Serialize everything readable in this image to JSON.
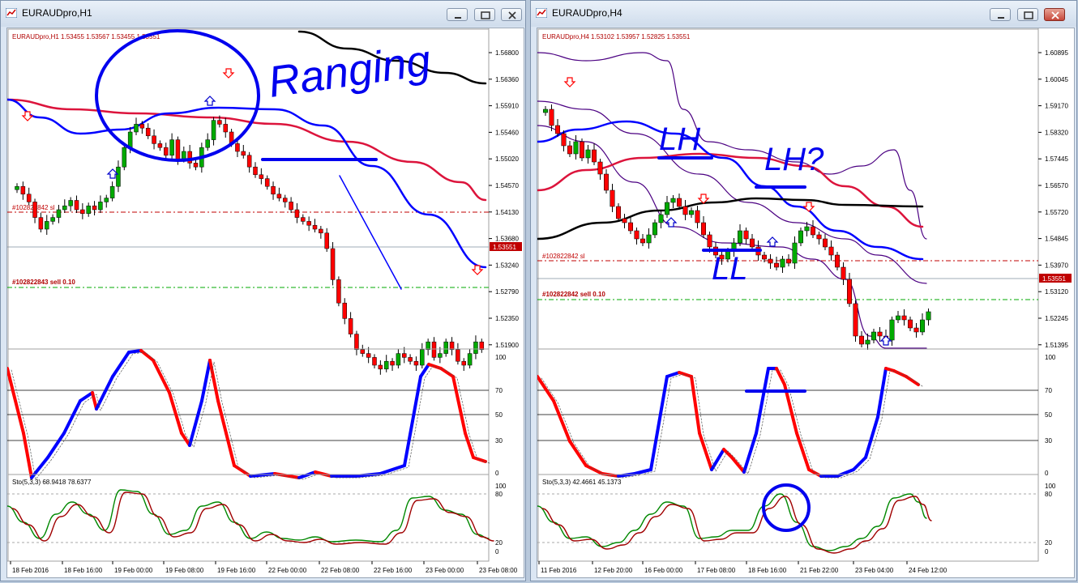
{
  "windows": [
    {
      "title": "EURAUDpro,H1",
      "header": "EURAUDpro,H1  1.53455 1.53567 1.53455 1.53551",
      "price_labels": [
        "1.56800",
        "1.56360",
        "1.55910",
        "1.55460",
        "1.55020",
        "1.54570",
        "1.54130",
        "1.53680",
        "1.53240",
        "1.52790",
        "1.52350",
        "1.51900"
      ],
      "current_price": "1.53551",
      "sl_label": "#102822842 sl",
      "sell_label": "#102822843 sell 0.10",
      "rsi_levels": [
        "100",
        "70",
        "50",
        "30",
        "0"
      ],
      "sto_label": "Sto(5,3,3) 68.9418 78.6377",
      "sto_levels": [
        "100",
        "80",
        "20",
        "0"
      ],
      "time_labels": [
        "18 Feb 2016",
        "18 Feb 16:00",
        "19 Feb 00:00",
        "19 Feb 08:00",
        "19 Feb 16:00",
        "22 Feb 00:00",
        "22 Feb 08:00",
        "22 Feb 16:00",
        "23 Feb 00:00",
        "23 Feb 08:00"
      ],
      "annotation": "Ranging"
    },
    {
      "title": "EURAUDpro,H4",
      "header": "EURAUDpro,H4  1.53102 1.53957 1.52825 1.53551",
      "price_labels": [
        "1.60895",
        "1.60045",
        "1.59170",
        "1.58320",
        "1.57445",
        "1.56570",
        "1.55720",
        "1.54845",
        "1.53970",
        "1.53120",
        "1.52245",
        "1.51395"
      ],
      "current_price": "1.53551",
      "sl_label": "#102822842 sl",
      "sell_label": "#102822842 sell 0.10",
      "rsi_levels": [
        "100",
        "70",
        "50",
        "30",
        "0"
      ],
      "sto_label": "Sto(5,3,3) 42.4661 45.1373",
      "sto_levels": [
        "100",
        "80",
        "20",
        "0"
      ],
      "time_labels": [
        "11 Feb 2016",
        "12 Feb 20:00",
        "16 Feb 00:00",
        "17 Feb 08:00",
        "18 Feb 16:00",
        "21 Feb 22:00",
        "23 Feb 04:00",
        "24 Feb 12:00"
      ],
      "annotations": [
        "LH",
        "LH?",
        "LL"
      ]
    }
  ],
  "colors": {
    "bull": "#00aa00",
    "bear": "#ff0000",
    "ma_red": "#dc143c",
    "ma_blue": "#0000ff",
    "ma_black": "#000000",
    "band": "#4b0082",
    "grid": "#c0c0c0",
    "price_tag": "#c00000"
  }
}
